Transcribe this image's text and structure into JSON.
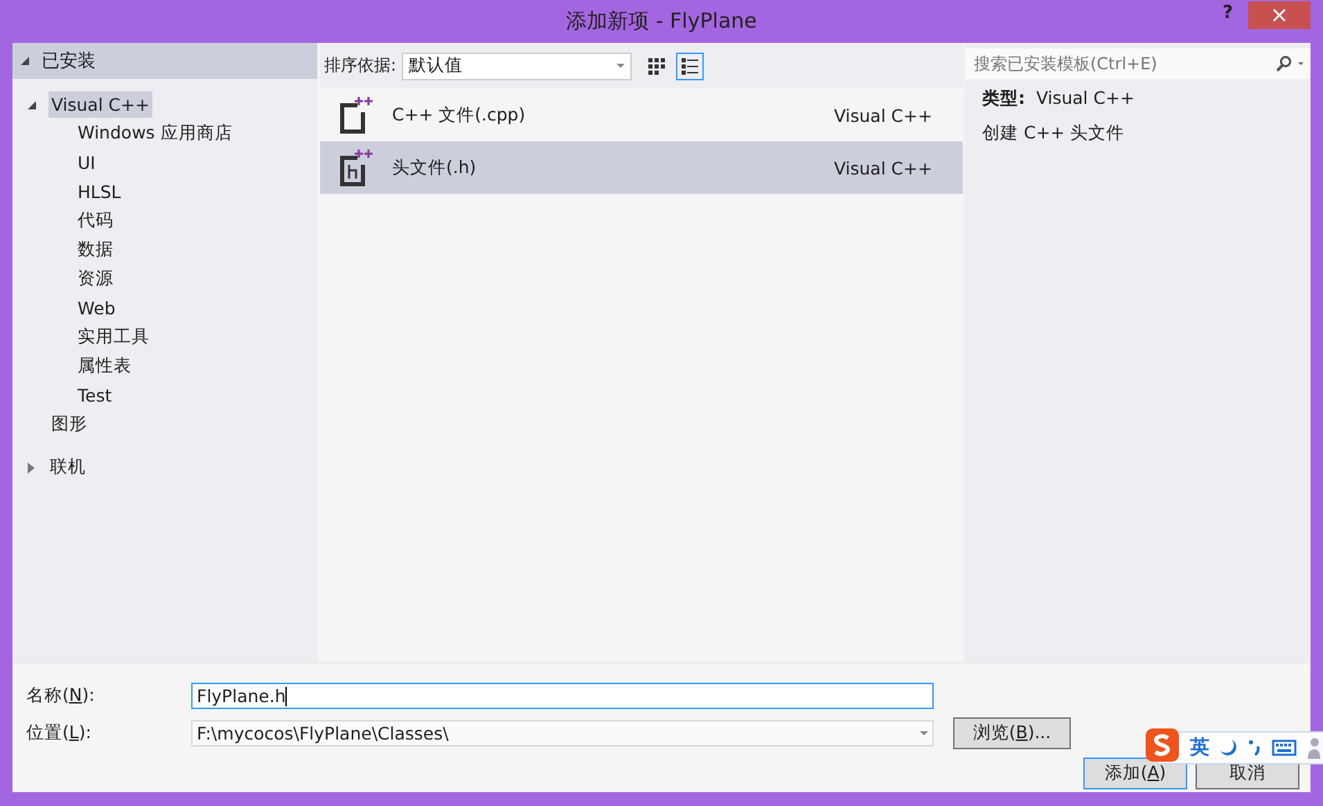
{
  "window": {
    "title": "添加新项 - FlyPlane",
    "help": "?",
    "close": "×"
  },
  "sidebar": {
    "header": {
      "label": "已安装",
      "expanded": true
    },
    "tree": [
      {
        "label": "Visual C++",
        "expanded": true,
        "selected": true,
        "children": [
          {
            "label": "Windows 应用商店",
            "selected": false
          },
          {
            "label": "UI",
            "selected": false
          },
          {
            "label": "HLSL",
            "selected": false
          },
          {
            "label": "代码",
            "selected": false
          },
          {
            "label": "数据",
            "selected": false
          },
          {
            "label": "资源",
            "selected": false
          },
          {
            "label": "Web",
            "selected": false
          },
          {
            "label": "实用工具",
            "selected": false
          },
          {
            "label": "属性表",
            "selected": false
          },
          {
            "label": "Test",
            "selected": false
          }
        ]
      },
      {
        "label": "图形",
        "selected": false
      }
    ],
    "online": {
      "label": "联机",
      "expanded": false
    }
  },
  "toolbar": {
    "sort_label": "排序依据:",
    "sort_value": "默认值",
    "views": [
      {
        "kind": "grid",
        "selected": false
      },
      {
        "kind": "list",
        "selected": true
      }
    ],
    "search": {
      "placeholder": "搜索已安装模板(Ctrl+E)"
    }
  },
  "templates": [
    {
      "name": "C++ 文件(.cpp)",
      "type": "Visual C++",
      "kind": "cpp",
      "selected": false
    },
    {
      "name": "头文件(.h)",
      "type": "Visual C++",
      "kind": "h",
      "selected": true
    }
  ],
  "details": {
    "type_label": "类型:",
    "type_value": "Visual C++",
    "description": "创建 C++ 头文件"
  },
  "form": [
    {
      "before": "名称(",
      "key": "N",
      "after": "):",
      "value": "FlyPlane.h",
      "kind": "text"
    },
    {
      "before": "位置(",
      "key": "L",
      "after": "):",
      "value": "F:\\mycocos\\FlyPlane\\Classes\\",
      "kind": "combo"
    }
  ],
  "browse_button": {
    "before": "浏览(",
    "key": "B",
    "after": ")..."
  },
  "buttons": [
    {
      "before": "添加(",
      "key": "A",
      "after": ")",
      "default": true
    },
    {
      "before": "取消",
      "default": false
    }
  ],
  "ime": {
    "label": "英"
  }
}
